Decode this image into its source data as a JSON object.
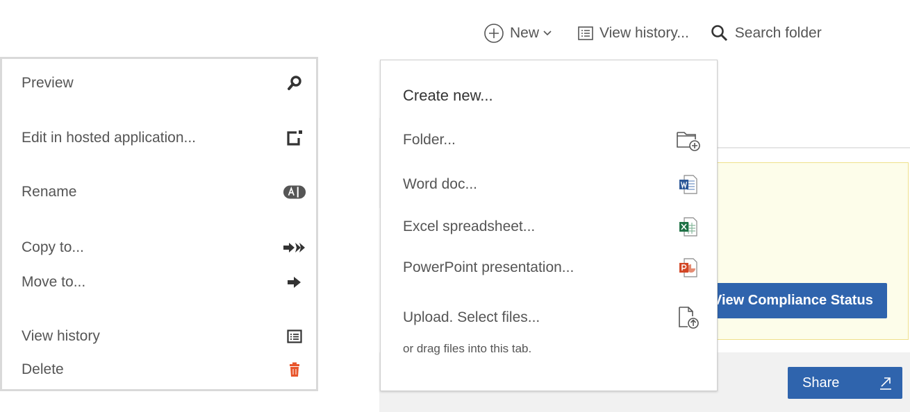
{
  "toolbar": {
    "new_label": "New",
    "history_label": "View history...",
    "search_label": "Search folder"
  },
  "context_menu": {
    "items": [
      {
        "label": "Preview",
        "icon": "magnifier-icon"
      },
      {
        "label": "Edit in hosted application...",
        "icon": "edit-external-icon"
      },
      {
        "label": "Rename",
        "icon": "rename-icon"
      },
      {
        "label": "Copy to...",
        "icon": "copy-to-icon"
      },
      {
        "label": "Move to...",
        "icon": "move-to-icon"
      },
      {
        "label": "View history",
        "icon": "history-list-icon"
      },
      {
        "label": "Delete",
        "icon": "trash-icon"
      }
    ]
  },
  "new_menu": {
    "title": "Create new...",
    "items": [
      {
        "label": "Folder...",
        "icon": "folder-add-icon"
      },
      {
        "label": "Word doc...",
        "icon": "word-doc-icon"
      },
      {
        "label": "Excel spreadsheet...",
        "icon": "excel-icon"
      },
      {
        "label": "PowerPoint presentation...",
        "icon": "powerpoint-icon"
      },
      {
        "label": "Upload. Select files...",
        "icon": "upload-file-icon"
      }
    ],
    "hint": "or drag files into this tab."
  },
  "background": {
    "compliance_label": "View Compliance Status",
    "share_label": "Share"
  },
  "colors": {
    "primary_button": "#2f64ad",
    "delete_icon": "#e8552b",
    "word": "#2b5797",
    "excel": "#1e7145",
    "powerpoint": "#d24726",
    "notice_bg": "#fdfdea"
  }
}
